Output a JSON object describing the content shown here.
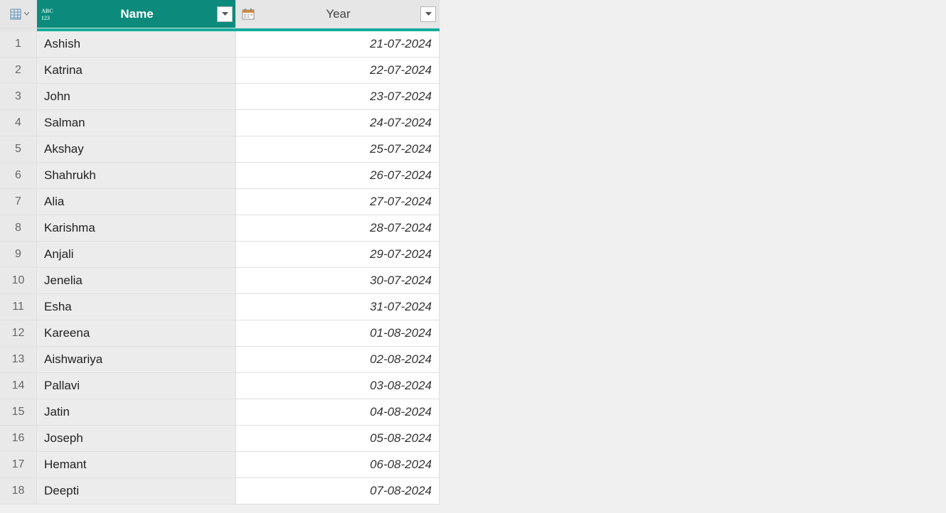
{
  "columns": {
    "name": {
      "label": "Name"
    },
    "year": {
      "label": "Year"
    }
  },
  "rows": [
    {
      "n": "1",
      "name": "Ashish",
      "year": "21-07-2024"
    },
    {
      "n": "2",
      "name": "Katrina",
      "year": "22-07-2024"
    },
    {
      "n": "3",
      "name": "John",
      "year": "23-07-2024"
    },
    {
      "n": "4",
      "name": "Salman",
      "year": "24-07-2024"
    },
    {
      "n": "5",
      "name": "Akshay",
      "year": "25-07-2024"
    },
    {
      "n": "6",
      "name": "Shahrukh",
      "year": "26-07-2024"
    },
    {
      "n": "7",
      "name": "Alia",
      "year": "27-07-2024"
    },
    {
      "n": "8",
      "name": "Karishma",
      "year": "28-07-2024"
    },
    {
      "n": "9",
      "name": "Anjali",
      "year": "29-07-2024"
    },
    {
      "n": "10",
      "name": "Jenelia",
      "year": "30-07-2024"
    },
    {
      "n": "11",
      "name": "Esha",
      "year": "31-07-2024"
    },
    {
      "n": "12",
      "name": "Kareena",
      "year": "01-08-2024"
    },
    {
      "n": "13",
      "name": "Aishwariya",
      "year": "02-08-2024"
    },
    {
      "n": "14",
      "name": "Pallavi",
      "year": "03-08-2024"
    },
    {
      "n": "15",
      "name": "Jatin",
      "year": "04-08-2024"
    },
    {
      "n": "16",
      "name": "Joseph",
      "year": "05-08-2024"
    },
    {
      "n": "17",
      "name": "Hemant",
      "year": "06-08-2024"
    },
    {
      "n": "18",
      "name": "Deepti",
      "year": "07-08-2024"
    }
  ]
}
